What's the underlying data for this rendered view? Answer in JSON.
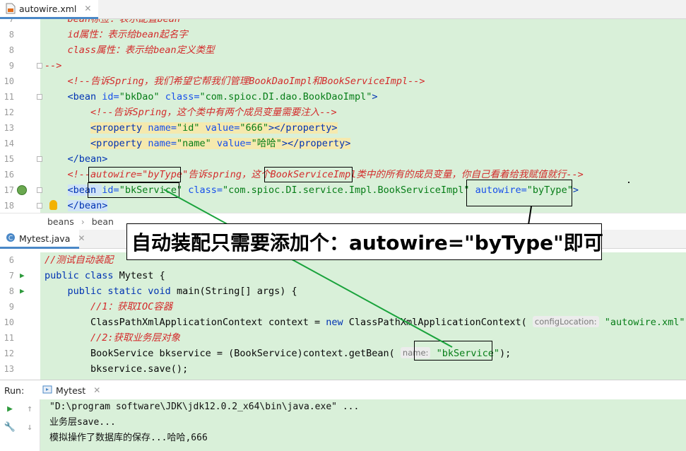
{
  "xml_tab": {
    "title": "autowire.xml"
  },
  "xml_lines": [
    {
      "num": "7",
      "parts": [
        {
          "t": "    bean标签：表示配置bean",
          "c": "c-cmt"
        }
      ]
    },
    {
      "num": "8",
      "parts": [
        {
          "t": "    id属性：表示给bean起名字",
          "c": "c-cmt"
        }
      ]
    },
    {
      "num": "8",
      "parts": [
        {
          "t": "    class属性：表示给bean定义类型",
          "c": "c-cmt"
        }
      ]
    },
    {
      "num": "9",
      "parts": [
        {
          "t": "-->",
          "c": "c-cmt"
        }
      ]
    },
    {
      "num": "10",
      "parts": [
        {
          "t": "    <!--告诉Spring，我们希望它帮我们管理BookDaoImpl和BookServiceImpl-->",
          "c": "c-cmt"
        }
      ]
    },
    {
      "num": "11",
      "parts": [
        {
          "t": "    "
        },
        {
          "t": "<bean ",
          "c": "c-tag"
        },
        {
          "t": "id=",
          "c": "c-attr"
        },
        {
          "t": "\"bkDao\" ",
          "c": "c-val"
        },
        {
          "t": "class=",
          "c": "c-attr"
        },
        {
          "t": "\"com.spioc.DI.dao.BookDaoImpl\"",
          "c": "c-val"
        },
        {
          "t": ">",
          "c": "c-tag"
        }
      ]
    },
    {
      "num": "12",
      "parts": [
        {
          "t": "        <!--告诉Spring，这个类中有两个成员变量需要注入-->",
          "c": "c-cmt"
        }
      ]
    },
    {
      "num": "13",
      "parts": [
        {
          "t": "        "
        },
        {
          "t": "<property ",
          "c": "c-tag c-tagbg"
        },
        {
          "t": "name=",
          "c": "c-attr c-tagbg"
        },
        {
          "t": "\"id\" ",
          "c": "c-val c-tagbg"
        },
        {
          "t": "value=",
          "c": "c-attr c-tagbg"
        },
        {
          "t": "\"666\"",
          "c": "c-val c-tagbg"
        },
        {
          "t": "></property>",
          "c": "c-tag c-tagbg"
        }
      ]
    },
    {
      "num": "14",
      "parts": [
        {
          "t": "        "
        },
        {
          "t": "<property ",
          "c": "c-tag c-tagbg"
        },
        {
          "t": "name=",
          "c": "c-attr c-tagbg"
        },
        {
          "t": "\"name\" ",
          "c": "c-val c-tagbg"
        },
        {
          "t": "value=",
          "c": "c-attr c-tagbg"
        },
        {
          "t": "\"哈哈\"",
          "c": "c-val c-tagbg"
        },
        {
          "t": "></property>",
          "c": "c-tag c-tagbg"
        }
      ]
    },
    {
      "num": "15",
      "parts": [
        {
          "t": "    "
        },
        {
          "t": "</bean>",
          "c": "c-tag"
        }
      ]
    },
    {
      "num": "16",
      "parts": [
        {
          "t": "    <!--autowire=\"byType\"告诉spring，这个BookServiceImpl类中的所有的成员变量，你自己看着给我赋值就行-->",
          "c": "c-cmt"
        }
      ]
    },
    {
      "num": "17",
      "parts": [
        {
          "t": "    "
        },
        {
          "t": "<bean ",
          "c": "c-tag c-sel"
        },
        {
          "t": "id=",
          "c": "c-attr"
        },
        {
          "t": "\"bkService\" ",
          "c": "c-val"
        },
        {
          "t": "class=",
          "c": "c-attr"
        },
        {
          "t": "\"com.spioc.DI.service.Impl.BookServiceImpl\" ",
          "c": "c-val"
        },
        {
          "t": "autowire=",
          "c": "c-attr"
        },
        {
          "t": "\"byType\"",
          "c": "c-val"
        },
        {
          "t": ">",
          "c": "c-tag"
        }
      ]
    },
    {
      "num": "18",
      "parts": [
        {
          "t": "    "
        },
        {
          "t": "</bean>",
          "c": "c-tag c-sel"
        }
      ]
    }
  ],
  "breadcrumb": {
    "items": [
      "beans",
      "bean"
    ],
    "separator": "›"
  },
  "annotation": {
    "text": "自动装配只需要添加个：autowire=\"byType\"即可"
  },
  "java_tab": {
    "title": "Mytest.java"
  },
  "java_lines": [
    {
      "num": "6",
      "parts": [
        {
          "t": "//测试自动装配",
          "c": "c-cmt"
        }
      ]
    },
    {
      "num": "7",
      "run": true,
      "parts": [
        {
          "t": "public class ",
          "c": "c-kw"
        },
        {
          "t": "Mytest {"
        }
      ]
    },
    {
      "num": "8",
      "run": true,
      "parts": [
        {
          "t": "    "
        },
        {
          "t": "public static void ",
          "c": "c-kw"
        },
        {
          "t": "main(String[] args) {"
        }
      ]
    },
    {
      "num": "9",
      "parts": [
        {
          "t": "        //1：获取IOC容器",
          "c": "c-cmt"
        }
      ]
    },
    {
      "num": "10",
      "parts": [
        {
          "t": "        ClassPathXmlApplicationContext context = "
        },
        {
          "t": "new ",
          "c": "c-kw"
        },
        {
          "t": "ClassPathXmlApplicationContext( "
        },
        {
          "t": "configLocation:",
          "hint": true
        },
        {
          "t": " "
        },
        {
          "t": "\"autowire.xml\"",
          "c": "c-str"
        },
        {
          "t": ");"
        }
      ]
    },
    {
      "num": "11",
      "parts": [
        {
          "t": "        //2:获取业务层对象",
          "c": "c-cmt"
        }
      ]
    },
    {
      "num": "12",
      "parts": [
        {
          "t": "        BookService bkservice = (BookService)context.getBean( "
        },
        {
          "t": "name:",
          "hint": true
        },
        {
          "t": " "
        },
        {
          "t": "\"bkService\"",
          "c": "c-str"
        },
        {
          "t": ");"
        }
      ]
    },
    {
      "num": "13",
      "parts": [
        {
          "t": "        bkservice.save();"
        }
      ]
    }
  ],
  "run_panel": {
    "label": "Run:",
    "tab": "Mytest"
  },
  "console_lines": [
    "\"D:\\program software\\JDK\\jdk12.0.2_x64\\bin\\java.exe\" ...",
    "业务层save...",
    "模拟操作了数据库的保存...哈哈,666"
  ],
  "colors": {
    "editor_bg": "#d9f0d9",
    "keyword": "#0033b3",
    "string": "#067d17",
    "comment": "#d32b2b",
    "arrow": "#1aa33c"
  }
}
